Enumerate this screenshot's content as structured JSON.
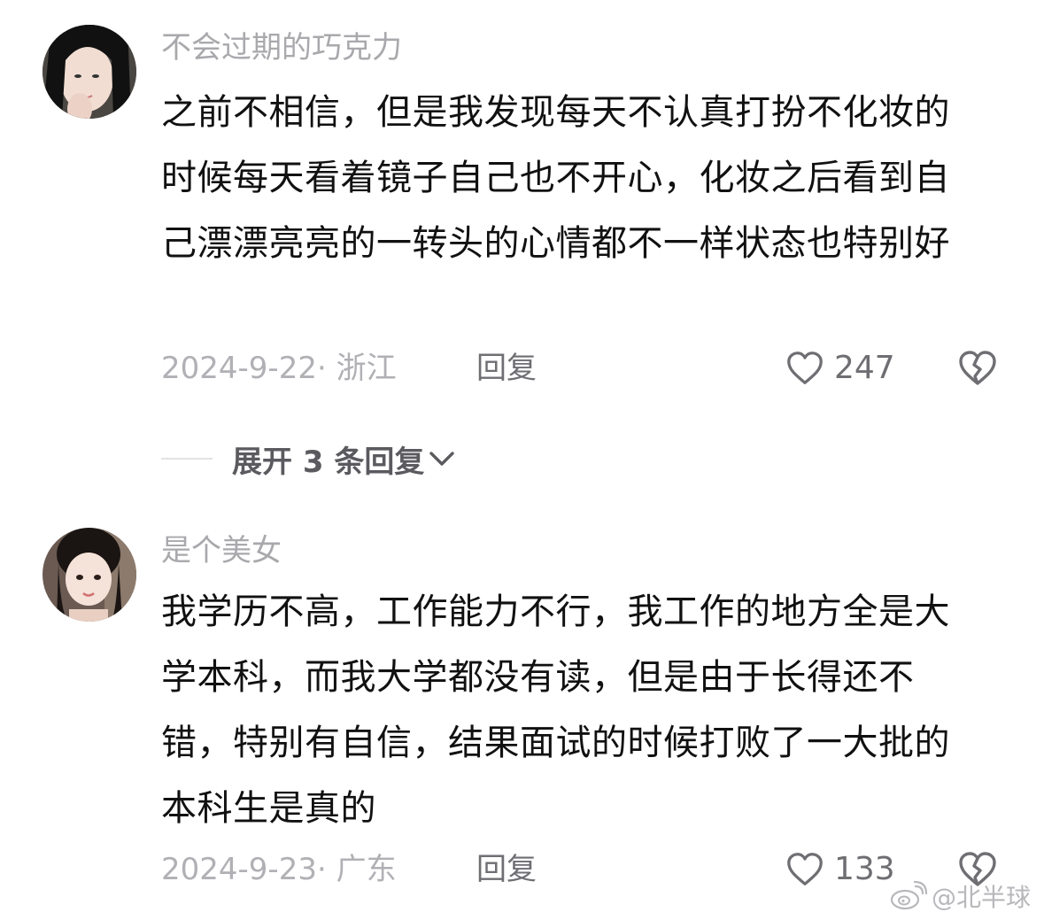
{
  "comments": [
    {
      "username": "不会过期的巧克力",
      "text": "之前不相信，但是我发现每天不认真打扮不化妆的时候每天看着镜子自己也不开心，化妆之后看到自己漂漂亮亮的一转头的心情都不一样状态也特别好",
      "meta": "2024-9-22· 浙江",
      "reply_label": "回复",
      "like_count": "247",
      "like_icon": "heart-outline-icon",
      "dislike_icon": "broken-heart-icon"
    },
    {
      "username": "是个美女",
      "text": "我学历不高，工作能力不行，我工作的地方全是大学本科，而我大学都没有读，但是由于长得还不错，特别有自信，结果面试的时候打败了一大批的本科生是真的",
      "meta": "2024-9-23· 广东",
      "reply_label": "回复",
      "like_count": "133",
      "like_icon": "heart-outline-icon",
      "dislike_icon": "broken-heart-icon"
    }
  ],
  "expand_replies": {
    "label": "展开 3 条回复",
    "icon": "chevron-down-icon"
  },
  "watermark": {
    "text": "@北半球",
    "icon": "weibo-icon"
  },
  "colors": {
    "username": "#a9a9ad",
    "meta": "#b0b0b5",
    "action": "#6e6e73",
    "text": "#111111"
  }
}
